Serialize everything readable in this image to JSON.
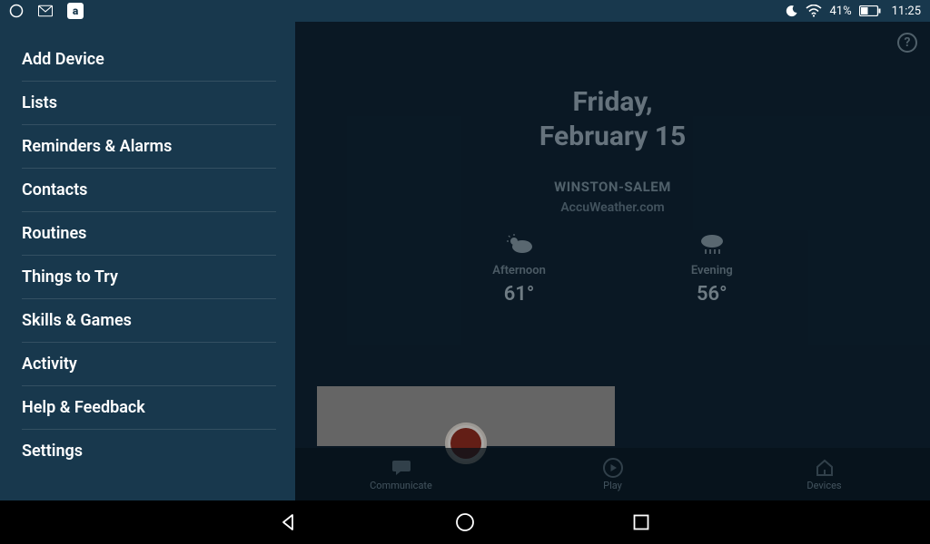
{
  "status": {
    "battery_pct": "41%",
    "time": "11:25"
  },
  "sidebar": {
    "items": [
      {
        "label": "Add Device"
      },
      {
        "label": "Lists"
      },
      {
        "label": "Reminders & Alarms"
      },
      {
        "label": "Contacts"
      },
      {
        "label": "Routines"
      },
      {
        "label": "Things to Try"
      },
      {
        "label": "Skills & Games"
      },
      {
        "label": "Activity"
      },
      {
        "label": "Help & Feedback"
      },
      {
        "label": "Settings"
      }
    ]
  },
  "main": {
    "date_line1": "Friday,",
    "date_line2": "February 15",
    "location": "WINSTON-SALEM",
    "source": "AccuWeather.com",
    "forecast": [
      {
        "label": "Afternoon",
        "temp": "61°",
        "icon": "partly-cloudy"
      },
      {
        "label": "Evening",
        "temp": "56°",
        "icon": "rain"
      }
    ],
    "help_glyph": "?"
  },
  "tabs": [
    {
      "label": "Communicate"
    },
    {
      "label": "Play"
    },
    {
      "label": "Devices"
    }
  ]
}
